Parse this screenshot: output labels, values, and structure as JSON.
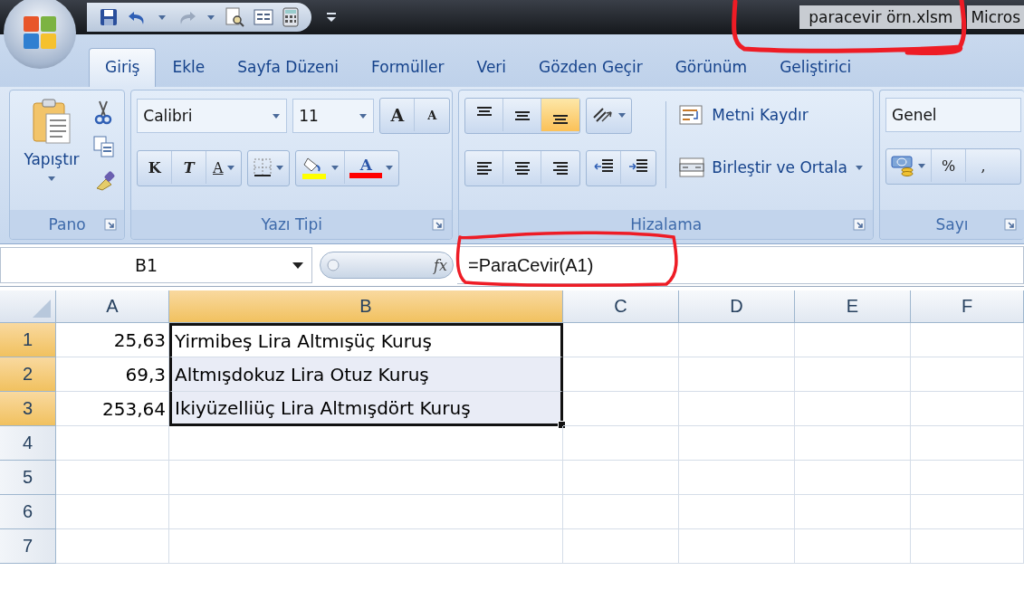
{
  "title_bar": {
    "file_name": "paracevir örn.xlsm",
    "app_name": "Micros"
  },
  "tabs": [
    {
      "label": "Giriş",
      "selected": true
    },
    {
      "label": "Ekle",
      "selected": false
    },
    {
      "label": "Sayfa Düzeni",
      "selected": false
    },
    {
      "label": "Formüller",
      "selected": false
    },
    {
      "label": "Veri",
      "selected": false
    },
    {
      "label": "Gözden Geçir",
      "selected": false
    },
    {
      "label": "Görünüm",
      "selected": false
    },
    {
      "label": "Geliştirici",
      "selected": false
    }
  ],
  "ribbon": {
    "clipboard": {
      "label": "Pano",
      "paste": "Yapıştır"
    },
    "font": {
      "label": "Yazı Tipi",
      "font_name": "Calibri",
      "font_size": "11",
      "grow": "A",
      "shrink": "A",
      "bold": "K",
      "italic": "T",
      "underline": "A",
      "font_color": "A"
    },
    "alignment": {
      "label": "Hizalama",
      "vertical_align": [
        {
          "selected": false
        },
        {
          "selected": false
        },
        {
          "selected": true
        }
      ],
      "horizontal_align": [
        {
          "selected": false
        },
        {
          "selected": false
        },
        {
          "selected": false
        }
      ],
      "wrap_text": "Metni Kaydır",
      "merge_center": "Birleştir ve Ortala"
    },
    "number": {
      "label": "Sayı",
      "format": "Genel",
      "percent": "%",
      "comma": ","
    }
  },
  "formula_bar": {
    "name_box": "B1",
    "function_label": "fx",
    "formula": "=ParaCevir(A1)"
  },
  "sheet": {
    "columns": [
      {
        "label": "A",
        "selected": false
      },
      {
        "label": "B",
        "selected": true
      },
      {
        "label": "C",
        "selected": false
      },
      {
        "label": "D",
        "selected": false
      },
      {
        "label": "E",
        "selected": false
      },
      {
        "label": "F",
        "selected": false
      }
    ],
    "rows": [
      {
        "label": "1",
        "selected": true,
        "cells": [
          {
            "text": "25,63",
            "selected": false
          },
          {
            "text": "Yirmibeş Lira Altmışüç Kuruş",
            "selected": true,
            "active": true
          }
        ]
      },
      {
        "label": "2",
        "selected": true,
        "cells": [
          {
            "text": "69,3",
            "selected": false
          },
          {
            "text": "Altmışdokuz Lira Otuz Kuruş",
            "selected": true,
            "active": false
          }
        ]
      },
      {
        "label": "3",
        "selected": true,
        "cells": [
          {
            "text": "253,64",
            "selected": false
          },
          {
            "text": "Ikiyüzelliüç Lira Altmışdört Kuruş",
            "selected": true,
            "active": false
          }
        ]
      },
      {
        "label": "4",
        "selected": false
      },
      {
        "label": "5",
        "selected": false
      },
      {
        "label": "6",
        "selected": false
      },
      {
        "label": "7",
        "selected": false
      }
    ]
  }
}
